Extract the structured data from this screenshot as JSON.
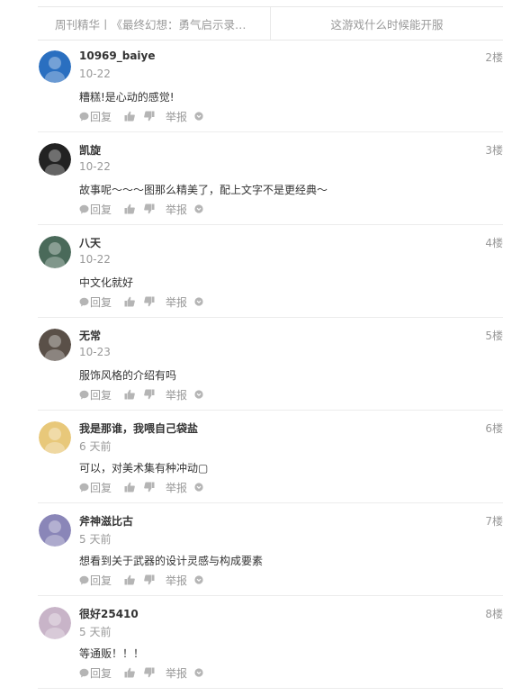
{
  "nav": {
    "prev_link": "周刊精华丨《最终幻想：勇气启示录》系列设定",
    "next_link": "这游戏什么时候能开服"
  },
  "actions": {
    "reply": "回复",
    "report": "举报"
  },
  "comments": [
    {
      "user": "10969_baiye",
      "time": "10-22",
      "floor": "2楼",
      "text": "糟糕!是心动的感觉!",
      "avatar_color": "#2a6fc0"
    },
    {
      "user": "凯旋",
      "time": "10-22",
      "floor": "3楼",
      "text": "故事呢～～～图那么精美了，配上文字不是更经典～",
      "avatar_color": "#222222"
    },
    {
      "user": "八天",
      "time": "10-22",
      "floor": "4楼",
      "text": "中文化就好",
      "avatar_color": "#4a6a5a"
    },
    {
      "user": "无常",
      "time": "10-23",
      "floor": "5楼",
      "text": "服饰风格的介绍有吗",
      "avatar_color": "#5a5048"
    },
    {
      "user": "我是那谁，我喂自己袋盐",
      "time": "6 天前",
      "floor": "6楼",
      "text": "可以，对美术集有种冲动▢",
      "avatar_color": "#e8c87a"
    },
    {
      "user": "斧神滋比古",
      "time": "5 天前",
      "floor": "7楼",
      "text": "想看到关于武器的设计灵感与构成要素",
      "avatar_color": "#8a86b8"
    },
    {
      "user": "很好25410",
      "time": "5 天前",
      "floor": "8楼",
      "text": "等通贩！！！",
      "avatar_color": "#c8b4c8"
    }
  ]
}
